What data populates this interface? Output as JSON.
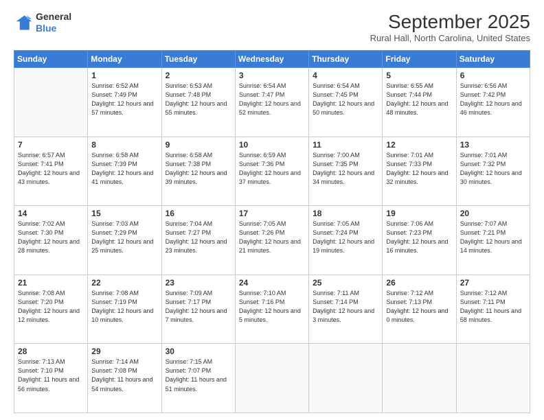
{
  "header": {
    "logo": {
      "general": "General",
      "blue": "Blue"
    },
    "title": "September 2025",
    "location": "Rural Hall, North Carolina, United States"
  },
  "weekdays": [
    "Sunday",
    "Monday",
    "Tuesday",
    "Wednesday",
    "Thursday",
    "Friday",
    "Saturday"
  ],
  "weeks": [
    [
      {
        "day": "",
        "sunrise": "",
        "sunset": "",
        "daylight": ""
      },
      {
        "day": "1",
        "sunrise": "Sunrise: 6:52 AM",
        "sunset": "Sunset: 7:49 PM",
        "daylight": "Daylight: 12 hours and 57 minutes."
      },
      {
        "day": "2",
        "sunrise": "Sunrise: 6:53 AM",
        "sunset": "Sunset: 7:48 PM",
        "daylight": "Daylight: 12 hours and 55 minutes."
      },
      {
        "day": "3",
        "sunrise": "Sunrise: 6:54 AM",
        "sunset": "Sunset: 7:47 PM",
        "daylight": "Daylight: 12 hours and 52 minutes."
      },
      {
        "day": "4",
        "sunrise": "Sunrise: 6:54 AM",
        "sunset": "Sunset: 7:45 PM",
        "daylight": "Daylight: 12 hours and 50 minutes."
      },
      {
        "day": "5",
        "sunrise": "Sunrise: 6:55 AM",
        "sunset": "Sunset: 7:44 PM",
        "daylight": "Daylight: 12 hours and 48 minutes."
      },
      {
        "day": "6",
        "sunrise": "Sunrise: 6:56 AM",
        "sunset": "Sunset: 7:42 PM",
        "daylight": "Daylight: 12 hours and 46 minutes."
      }
    ],
    [
      {
        "day": "7",
        "sunrise": "Sunrise: 6:57 AM",
        "sunset": "Sunset: 7:41 PM",
        "daylight": "Daylight: 12 hours and 43 minutes."
      },
      {
        "day": "8",
        "sunrise": "Sunrise: 6:58 AM",
        "sunset": "Sunset: 7:39 PM",
        "daylight": "Daylight: 12 hours and 41 minutes."
      },
      {
        "day": "9",
        "sunrise": "Sunrise: 6:58 AM",
        "sunset": "Sunset: 7:38 PM",
        "daylight": "Daylight: 12 hours and 39 minutes."
      },
      {
        "day": "10",
        "sunrise": "Sunrise: 6:59 AM",
        "sunset": "Sunset: 7:36 PM",
        "daylight": "Daylight: 12 hours and 37 minutes."
      },
      {
        "day": "11",
        "sunrise": "Sunrise: 7:00 AM",
        "sunset": "Sunset: 7:35 PM",
        "daylight": "Daylight: 12 hours and 34 minutes."
      },
      {
        "day": "12",
        "sunrise": "Sunrise: 7:01 AM",
        "sunset": "Sunset: 7:33 PM",
        "daylight": "Daylight: 12 hours and 32 minutes."
      },
      {
        "day": "13",
        "sunrise": "Sunrise: 7:01 AM",
        "sunset": "Sunset: 7:32 PM",
        "daylight": "Daylight: 12 hours and 30 minutes."
      }
    ],
    [
      {
        "day": "14",
        "sunrise": "Sunrise: 7:02 AM",
        "sunset": "Sunset: 7:30 PM",
        "daylight": "Daylight: 12 hours and 28 minutes."
      },
      {
        "day": "15",
        "sunrise": "Sunrise: 7:03 AM",
        "sunset": "Sunset: 7:29 PM",
        "daylight": "Daylight: 12 hours and 25 minutes."
      },
      {
        "day": "16",
        "sunrise": "Sunrise: 7:04 AM",
        "sunset": "Sunset: 7:27 PM",
        "daylight": "Daylight: 12 hours and 23 minutes."
      },
      {
        "day": "17",
        "sunrise": "Sunrise: 7:05 AM",
        "sunset": "Sunset: 7:26 PM",
        "daylight": "Daylight: 12 hours and 21 minutes."
      },
      {
        "day": "18",
        "sunrise": "Sunrise: 7:05 AM",
        "sunset": "Sunset: 7:24 PM",
        "daylight": "Daylight: 12 hours and 19 minutes."
      },
      {
        "day": "19",
        "sunrise": "Sunrise: 7:06 AM",
        "sunset": "Sunset: 7:23 PM",
        "daylight": "Daylight: 12 hours and 16 minutes."
      },
      {
        "day": "20",
        "sunrise": "Sunrise: 7:07 AM",
        "sunset": "Sunset: 7:21 PM",
        "daylight": "Daylight: 12 hours and 14 minutes."
      }
    ],
    [
      {
        "day": "21",
        "sunrise": "Sunrise: 7:08 AM",
        "sunset": "Sunset: 7:20 PM",
        "daylight": "Daylight: 12 hours and 12 minutes."
      },
      {
        "day": "22",
        "sunrise": "Sunrise: 7:08 AM",
        "sunset": "Sunset: 7:19 PM",
        "daylight": "Daylight: 12 hours and 10 minutes."
      },
      {
        "day": "23",
        "sunrise": "Sunrise: 7:09 AM",
        "sunset": "Sunset: 7:17 PM",
        "daylight": "Daylight: 12 hours and 7 minutes."
      },
      {
        "day": "24",
        "sunrise": "Sunrise: 7:10 AM",
        "sunset": "Sunset: 7:16 PM",
        "daylight": "Daylight: 12 hours and 5 minutes."
      },
      {
        "day": "25",
        "sunrise": "Sunrise: 7:11 AM",
        "sunset": "Sunset: 7:14 PM",
        "daylight": "Daylight: 12 hours and 3 minutes."
      },
      {
        "day": "26",
        "sunrise": "Sunrise: 7:12 AM",
        "sunset": "Sunset: 7:13 PM",
        "daylight": "Daylight: 12 hours and 0 minutes."
      },
      {
        "day": "27",
        "sunrise": "Sunrise: 7:12 AM",
        "sunset": "Sunset: 7:11 PM",
        "daylight": "Daylight: 11 hours and 58 minutes."
      }
    ],
    [
      {
        "day": "28",
        "sunrise": "Sunrise: 7:13 AM",
        "sunset": "Sunset: 7:10 PM",
        "daylight": "Daylight: 11 hours and 56 minutes."
      },
      {
        "day": "29",
        "sunrise": "Sunrise: 7:14 AM",
        "sunset": "Sunset: 7:08 PM",
        "daylight": "Daylight: 11 hours and 54 minutes."
      },
      {
        "day": "30",
        "sunrise": "Sunrise: 7:15 AM",
        "sunset": "Sunset: 7:07 PM",
        "daylight": "Daylight: 11 hours and 51 minutes."
      },
      {
        "day": "",
        "sunrise": "",
        "sunset": "",
        "daylight": ""
      },
      {
        "day": "",
        "sunrise": "",
        "sunset": "",
        "daylight": ""
      },
      {
        "day": "",
        "sunrise": "",
        "sunset": "",
        "daylight": ""
      },
      {
        "day": "",
        "sunrise": "",
        "sunset": "",
        "daylight": ""
      }
    ]
  ]
}
